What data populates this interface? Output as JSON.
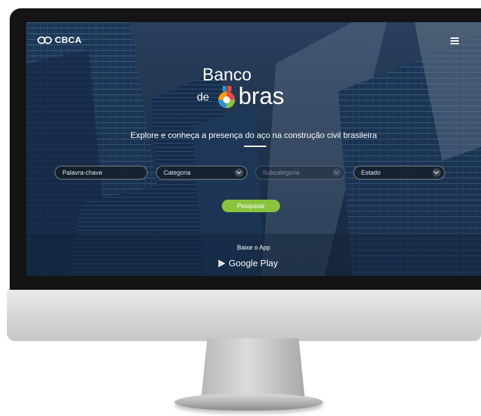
{
  "header": {
    "logo_text": "CBCA",
    "menu_icon": "hamburger-menu-icon"
  },
  "brand": {
    "line1": "Banco",
    "prefix": "de",
    "suffix": "bras",
    "mark_colors": [
      "#f39c12",
      "#e84c3d",
      "#2e8fd3",
      "#8ac43f"
    ]
  },
  "hero": {
    "tagline": "Explore e conheça a presença do aço na construção civil brasileira"
  },
  "search": {
    "keyword_placeholder": "Palavra-chave",
    "category_label": "Categoria",
    "subcategory_label": "Subcategoria",
    "state_label": "Estado",
    "button_label": "Pesquisar"
  },
  "app": {
    "label": "Baixe o App",
    "store_label": "Google Play"
  },
  "colors": {
    "accent_green": "#8ac43f",
    "screen_background": "#16273d"
  }
}
